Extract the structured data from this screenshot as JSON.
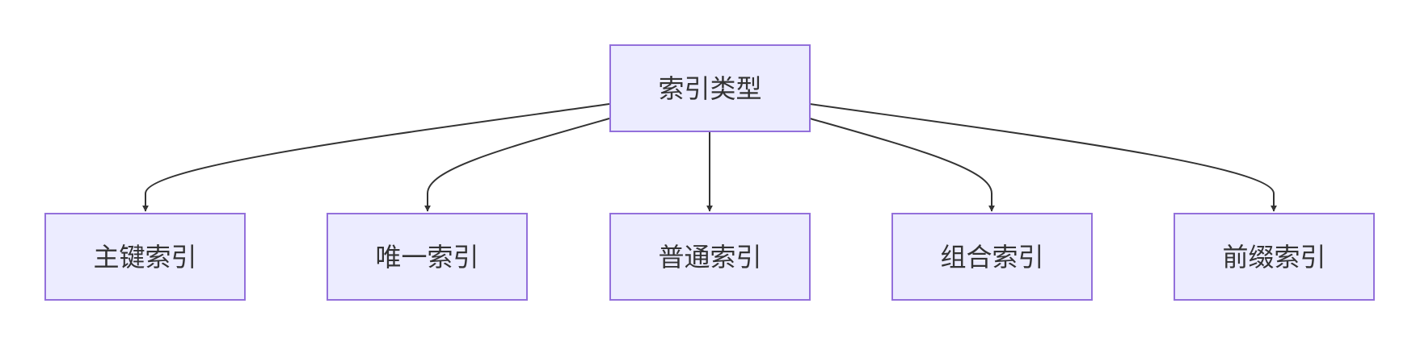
{
  "diagram": {
    "type": "flowchart",
    "direction": "top-down",
    "colors": {
      "node_fill": "#ECECFF",
      "node_border": "#9370DB",
      "text": "#333333",
      "edge": "#333333",
      "background": "#FFFFFF"
    },
    "root": {
      "id": "root",
      "label": "索引类型"
    },
    "children": [
      {
        "id": "c1",
        "label": "主键索引"
      },
      {
        "id": "c2",
        "label": "唯一索引"
      },
      {
        "id": "c3",
        "label": "普通索引"
      },
      {
        "id": "c4",
        "label": "组合索引"
      },
      {
        "id": "c5",
        "label": "前缀索引"
      }
    ],
    "edges": [
      {
        "from": "root",
        "to": "c1"
      },
      {
        "from": "root",
        "to": "c2"
      },
      {
        "from": "root",
        "to": "c3"
      },
      {
        "from": "root",
        "to": "c4"
      },
      {
        "from": "root",
        "to": "c5"
      }
    ]
  }
}
